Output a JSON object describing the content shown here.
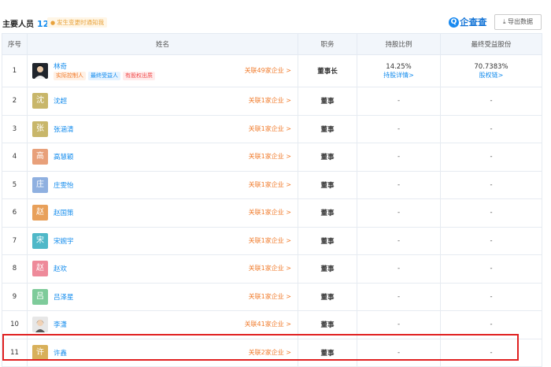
{
  "header": {
    "title": "主要人员",
    "count": "12",
    "notify_label": "发生变更时通知我",
    "logo_text": "企查查",
    "export_label": "导出数据"
  },
  "table": {
    "columns": [
      "序号",
      "姓名",
      "职务",
      "持股比例",
      "最终受益股份"
    ],
    "rows": [
      {
        "no": "1",
        "avatar": "",
        "avatar_color": "#20252c",
        "name": "林奇",
        "tags": [
          "实际控制人",
          "最终受益人",
          "有股权出质"
        ],
        "related": "关联49家企业 >",
        "role": "董事长",
        "share": "14.25%",
        "share_link": "持股详情>",
        "benefit": "70.7383%",
        "benefit_link": "股权链>"
      },
      {
        "no": "2",
        "avatar": "沈",
        "avatar_color": "#c8b66a",
        "name": "沈超",
        "related": "关联1家企业 >",
        "role": "董事",
        "share": "-",
        "benefit": "-"
      },
      {
        "no": "3",
        "avatar": "张",
        "avatar_color": "#c8b66a",
        "name": "张涵清",
        "related": "关联1家企业 >",
        "role": "董事",
        "share": "-",
        "benefit": "-"
      },
      {
        "no": "4",
        "avatar": "高",
        "avatar_color": "#e8a07a",
        "name": "高慧颖",
        "related": "关联1家企业 >",
        "role": "董事",
        "share": "-",
        "benefit": "-"
      },
      {
        "no": "5",
        "avatar": "庄",
        "avatar_color": "#8fb0e0",
        "name": "庄雯怡",
        "related": "关联1家企业 >",
        "role": "董事",
        "share": "-",
        "benefit": "-"
      },
      {
        "no": "6",
        "avatar": "赵",
        "avatar_color": "#e8a05a",
        "name": "赵国策",
        "related": "关联1家企业 >",
        "role": "董事",
        "share": "-",
        "benefit": "-"
      },
      {
        "no": "7",
        "avatar": "宋",
        "avatar_color": "#4fb8c8",
        "name": "宋婉宇",
        "related": "关联1家企业 >",
        "role": "董事",
        "share": "-",
        "benefit": "-"
      },
      {
        "no": "8",
        "avatar": "赵",
        "avatar_color": "#ee8a9a",
        "name": "赵欢",
        "related": "关联1家企业 >",
        "role": "董事",
        "share": "-",
        "benefit": "-"
      },
      {
        "no": "9",
        "avatar": "吕",
        "avatar_color": "#7ecb9a",
        "name": "吕泽星",
        "related": "关联1家企业 >",
        "role": "董事",
        "share": "-",
        "benefit": "-"
      },
      {
        "no": "10",
        "avatar": "",
        "avatar_color": "#e7e7e7",
        "name": "李潇",
        "related": "关联41家企业 >",
        "role": "董事",
        "share": "-",
        "benefit": "-"
      },
      {
        "no": "11",
        "avatar": "许",
        "avatar_color": "#d8b05a",
        "name": "许鑫",
        "related": "关联2家企业 >",
        "role": "董事",
        "share": "-",
        "benefit": "-"
      }
    ]
  },
  "colors": {
    "accent": "#128bed",
    "related": "#f07a2a",
    "highlight": "#e02020"
  }
}
